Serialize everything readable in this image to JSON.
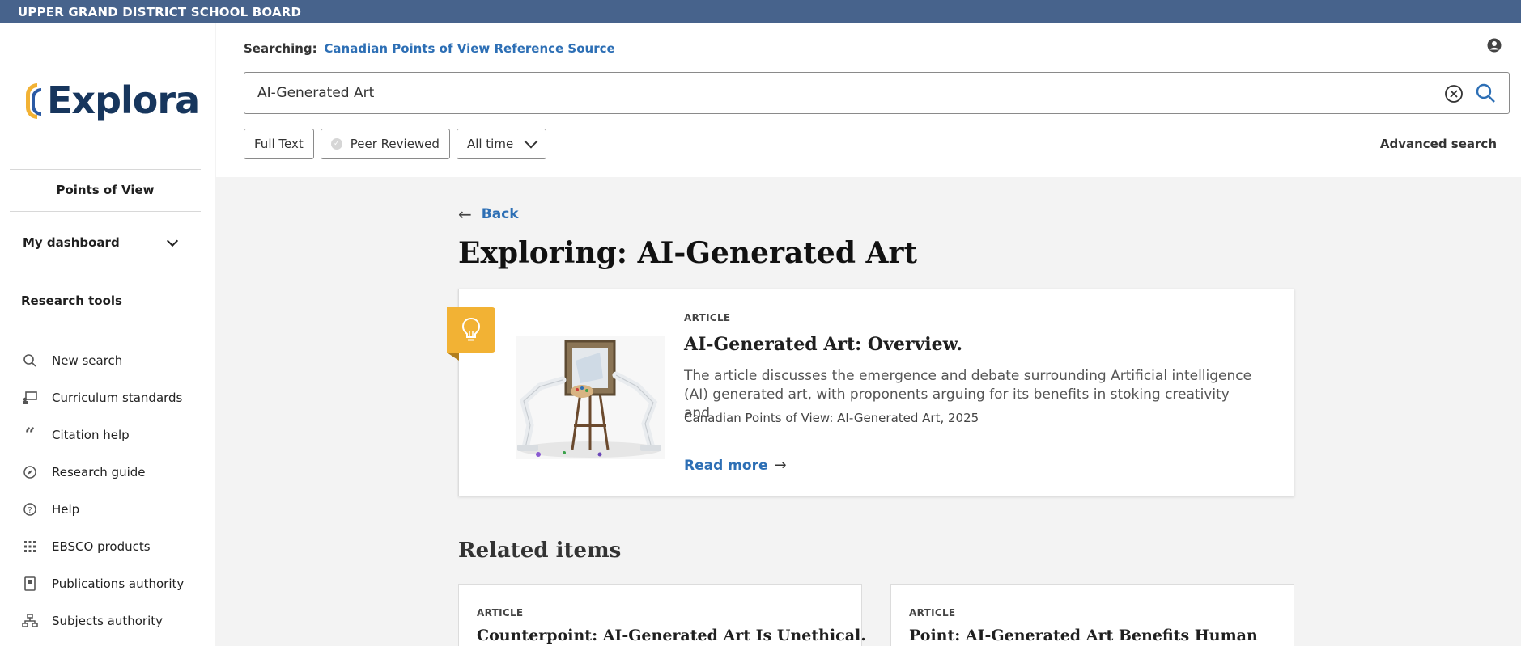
{
  "institution": {
    "name": "UPPER GRAND DISTRICT SCHOOL BOARD"
  },
  "sidebar": {
    "logo_text": "Explora",
    "section_label": "Points of View",
    "dashboard_label": "My dashboard",
    "research_tools_title": "Research tools",
    "tools": [
      {
        "label": "New search",
        "icon": "search-icon"
      },
      {
        "label": "Curriculum standards",
        "icon": "curriculum-icon"
      },
      {
        "label": "Citation help",
        "icon": "quote-icon"
      },
      {
        "label": "Research guide",
        "icon": "compass-icon"
      },
      {
        "label": "Help",
        "icon": "help-icon"
      },
      {
        "label": "EBSCO products",
        "icon": "grid-icon"
      },
      {
        "label": "Publications authority",
        "icon": "book-icon"
      },
      {
        "label": "Subjects authority",
        "icon": "hierarchy-icon"
      }
    ]
  },
  "header": {
    "searching_label": "Searching:",
    "searching_source": "Canadian Points of View Reference Source",
    "search_value": "AI-Generated Art",
    "filters": {
      "full_text": "Full Text",
      "peer_reviewed": "Peer Reviewed",
      "time": "All time"
    },
    "advanced_search": "Advanced search"
  },
  "main": {
    "back_label": "Back",
    "page_title": "Exploring: AI-Generated Art",
    "featured": {
      "type": "ARTICLE",
      "title": "AI-Generated Art: Overview.",
      "description": "The article discusses the emergence and debate surrounding Artificial intelligence (AI) generated art, with proponents arguing for its benefits in stoking creativity and...",
      "source": "Canadian Points of View: AI-Generated Art, 2025",
      "read_more": "Read more"
    },
    "related_title": "Related items",
    "related": [
      {
        "type": "ARTICLE",
        "title": "Counterpoint: AI-Generated Art Is Unethical."
      },
      {
        "type": "ARTICLE",
        "title": "Point: AI-Generated Art Benefits Human"
      }
    ]
  },
  "colors": {
    "topbar": "#47638c",
    "link": "#2d6fb5",
    "accent_yellow": "#f2b234",
    "logo_navy": "#17365d"
  }
}
